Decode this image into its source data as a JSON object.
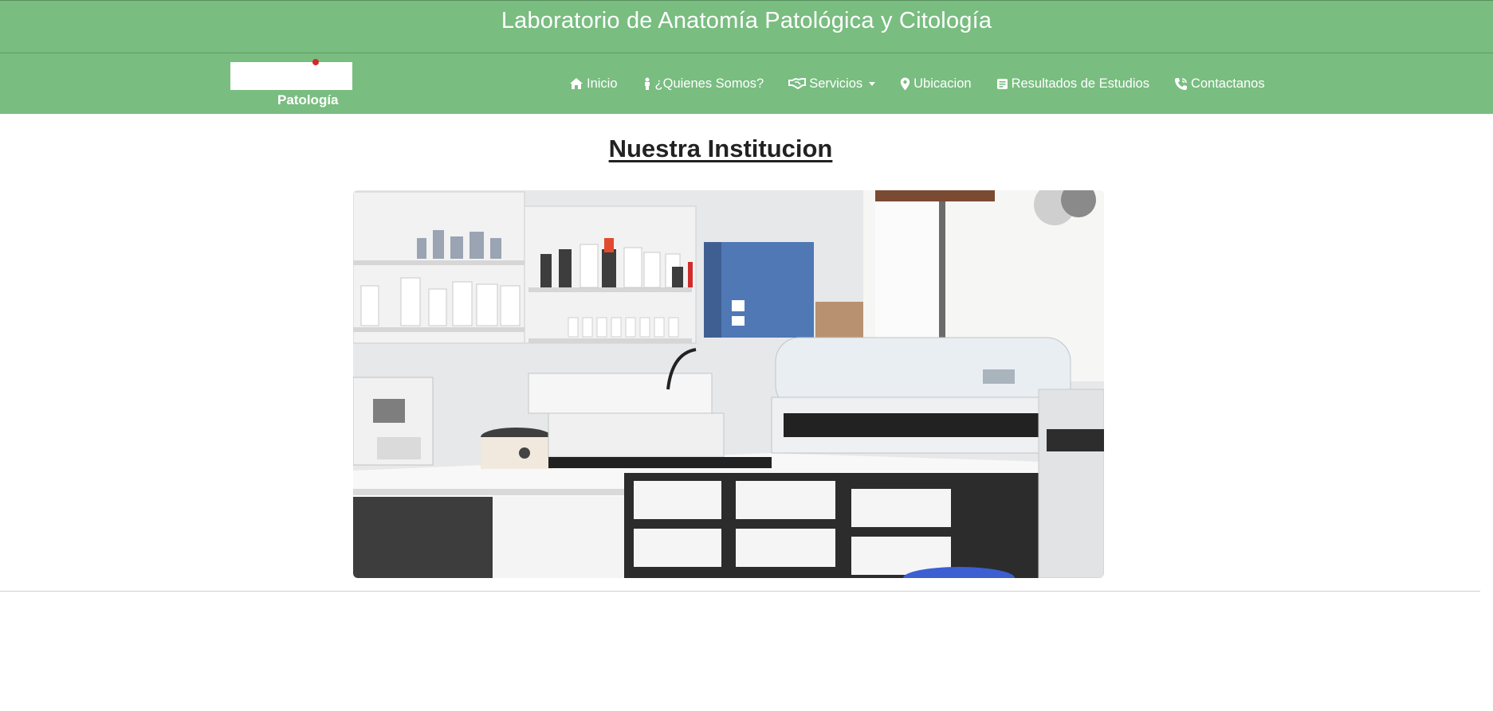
{
  "header": {
    "title": "Laboratorio de Anatomía Patológica y Citología"
  },
  "logo": {
    "text": "Patología"
  },
  "nav": {
    "items": [
      {
        "label": "Inicio",
        "icon": "home-icon"
      },
      {
        "label": "¿Quienes Somos?",
        "icon": "person-icon"
      },
      {
        "label": "Servicios",
        "icon": "handshake-icon",
        "dropdown": true
      },
      {
        "label": "Ubicacion",
        "icon": "map-marker-icon"
      },
      {
        "label": "Resultados de Estudios",
        "icon": "document-icon"
      },
      {
        "label": "Contactanos",
        "icon": "phone-icon"
      }
    ]
  },
  "main": {
    "heading": "Nuestra Institucion"
  },
  "colors": {
    "brand": "#79bd80",
    "text": "#222222"
  }
}
